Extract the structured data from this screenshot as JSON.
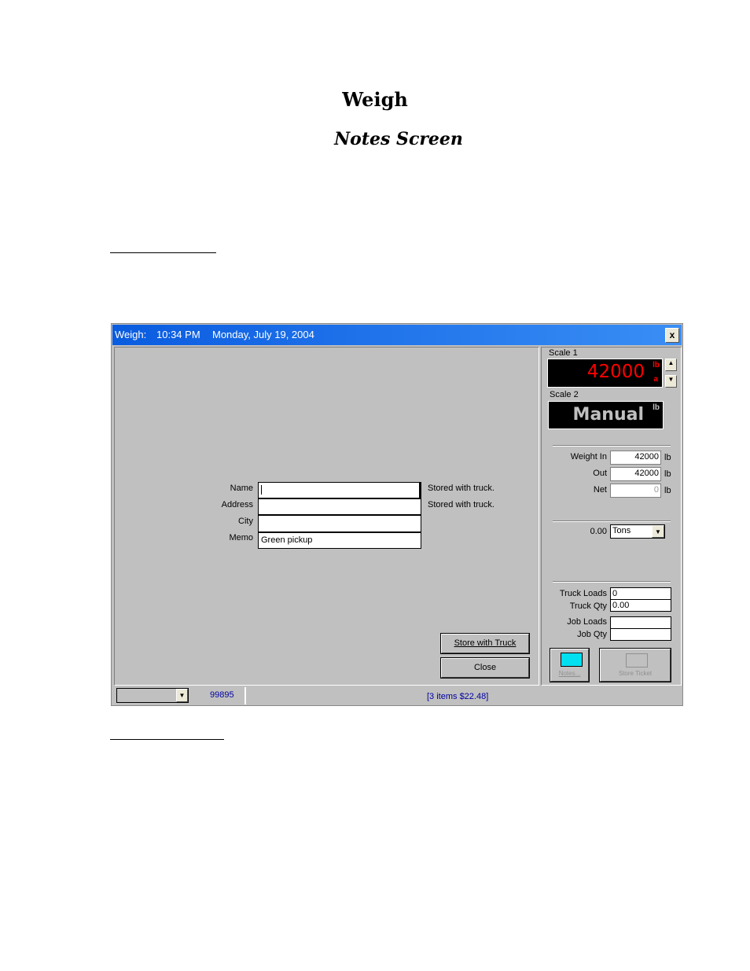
{
  "heading": "Weigh",
  "subheading": "Notes Screen",
  "window": {
    "title_app": "Weigh:",
    "title_time": "10:34 PM",
    "title_date": "Monday, July 19, 2004",
    "close_label": "x"
  },
  "form": {
    "name_label": "Name",
    "name_value": "",
    "address_label": "Address",
    "address_value": "",
    "city_label": "City",
    "city_value": "",
    "memo_label": "Memo",
    "memo_value": "Green pickup",
    "name_note": "Stored with truck.",
    "address_note": "Stored with truck.",
    "store_with_truck": "Store with Truck",
    "close": "Close"
  },
  "scales": {
    "scale1_label": "Scale 1",
    "scale1_value": "42000",
    "scale1_unit": "lb",
    "scale1_mode": "a",
    "scale2_label": "Scale 2",
    "scale2_value": "Manual",
    "scale2_unit": "lb"
  },
  "weights": {
    "in_label": "Weight In",
    "in_value": "42000",
    "out_label": "Out",
    "out_value": "42000",
    "net_label": "Net",
    "net_value": "0",
    "unit": "lb",
    "qty_value": "0.00",
    "qty_unit": "Tons"
  },
  "loads": {
    "truck_loads_label": "Truck Loads",
    "truck_loads_value": "0",
    "truck_qty_label": "Truck Qty",
    "truck_qty_value": "0.00",
    "job_loads_label": "Job Loads",
    "job_loads_value": "",
    "job_qty_label": "Job Qty",
    "job_qty_value": ""
  },
  "buttons": {
    "notes": "Notes...",
    "store_ticket": "Store Ticket"
  },
  "status": {
    "number": "99895",
    "items": "[3 items  $22.48]"
  },
  "colors": {
    "titlebar": "#0a5ce0",
    "scale_red": "#ff0000",
    "status_blue": "#0000a0"
  }
}
